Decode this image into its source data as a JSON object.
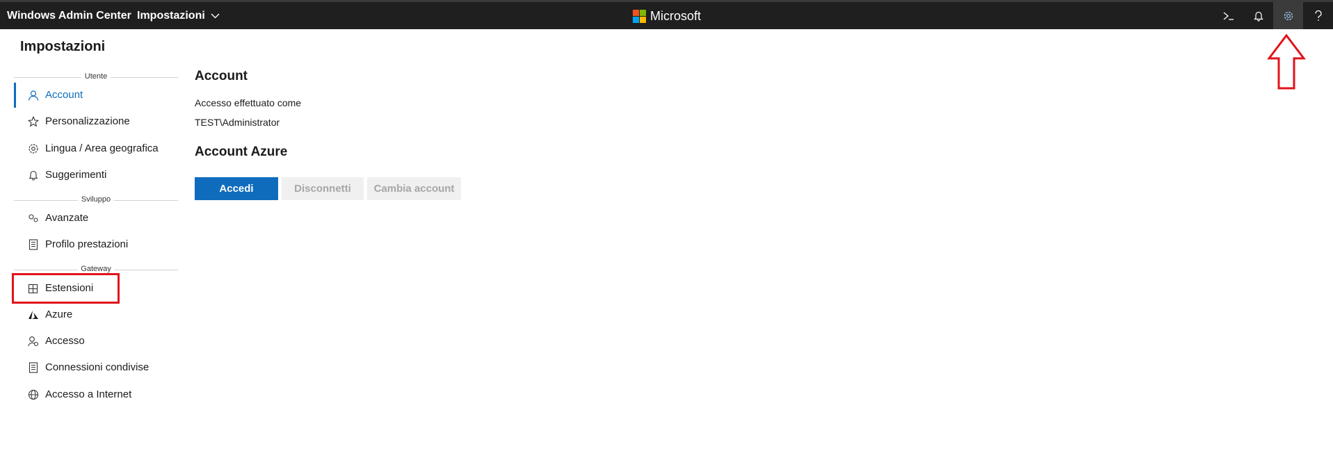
{
  "header": {
    "app_title": "Windows Admin Center",
    "tool_menu_label": "Impostazioni",
    "brand_name": "Microsoft",
    "brand_colors": [
      "#f25022",
      "#7fba00",
      "#00a4ef",
      "#ffb900"
    ],
    "icons": [
      "powershell-icon",
      "notifications-icon",
      "settings-icon",
      "help-icon"
    ]
  },
  "sidebar": {
    "title": "Impostazioni",
    "sections": [
      {
        "label": "Utente",
        "items": [
          {
            "label": "Account",
            "icon": "person-icon",
            "active": true
          },
          {
            "label": "Personalizzazione",
            "icon": "star-icon"
          },
          {
            "label": "Lingua / Area geografica",
            "icon": "gear-icon"
          },
          {
            "label": "Suggerimenti",
            "icon": "bell-icon"
          }
        ]
      },
      {
        "label": "Sviluppo",
        "items": [
          {
            "label": "Avanzate",
            "icon": "advanced-icon"
          },
          {
            "label": "Profilo prestazioni",
            "icon": "document-icon"
          }
        ]
      },
      {
        "label": "Gateway",
        "items": [
          {
            "label": "Estensioni",
            "icon": "extensions-icon"
          },
          {
            "label": "Azure",
            "icon": "azure-icon"
          },
          {
            "label": "Accesso",
            "icon": "access-icon"
          },
          {
            "label": "Connessioni condivise",
            "icon": "document-icon"
          },
          {
            "label": "Accesso a Internet",
            "icon": "globe-icon"
          }
        ]
      }
    ]
  },
  "main": {
    "account_heading": "Account",
    "signed_in_label": "Accesso effettuato come",
    "signed_in_user": "TEST\\Administrator",
    "azure_heading": "Account Azure",
    "buttons": {
      "sign_in": "Accedi",
      "sign_out": "Disconnetti",
      "switch_account": "Cambia account"
    }
  },
  "colors": {
    "accent": "#0f6cbd",
    "topbar": "#1f1f1f",
    "annotation": "#e1131b"
  }
}
